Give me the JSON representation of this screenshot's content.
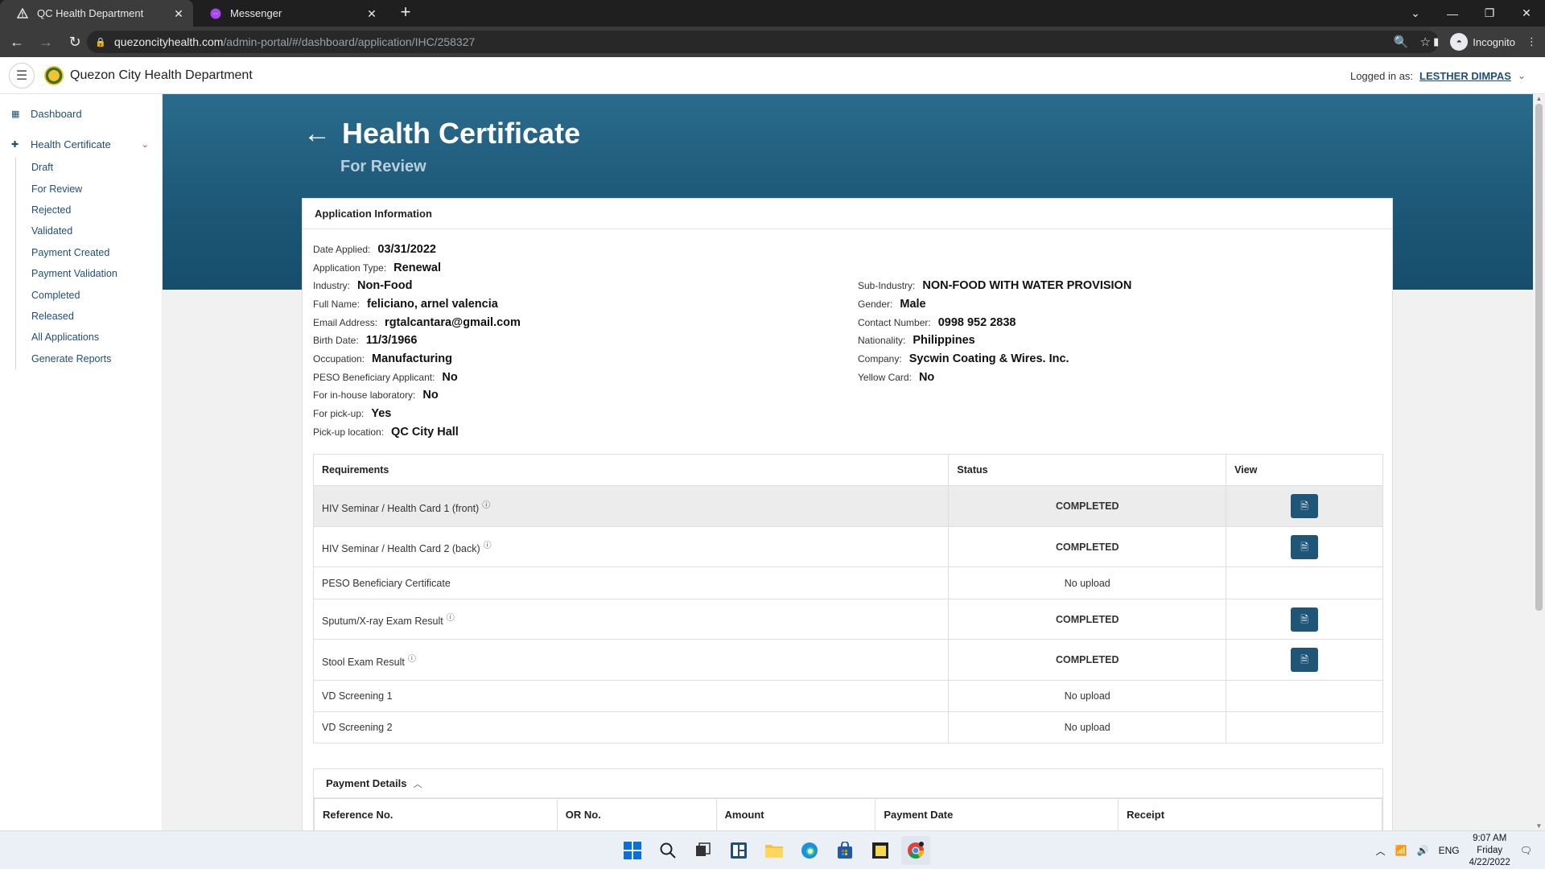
{
  "browser": {
    "tabs": [
      {
        "title": "QC Health Department",
        "icon": "triangle-warning-icon",
        "active": true
      },
      {
        "title": "Messenger",
        "icon": "messenger-icon",
        "active": false
      }
    ],
    "url_host": "quezoncityhealth.com",
    "url_path": "/admin-portal/#/dashboard/application/IHC/258327",
    "profile_label": "Incognito"
  },
  "header": {
    "app_title": "Quezon City Health Department",
    "logged_in_label": "Logged in as:",
    "user_name": "LESTHER DIMPAS"
  },
  "sidebar": {
    "dashboard": "Dashboard",
    "health_certificate": "Health Certificate",
    "sub_items": [
      "Draft",
      "For Review",
      "Rejected",
      "Validated",
      "Payment Created",
      "Payment Validation",
      "Completed",
      "Released",
      "All Applications",
      "Generate Reports"
    ]
  },
  "page": {
    "title": "Health Certificate",
    "subtitle": "For Review",
    "card_title": "Application Information"
  },
  "application": {
    "left": [
      {
        "label": "Date Applied:",
        "value": "03/31/2022"
      },
      {
        "label": "Application Type:",
        "value": "Renewal"
      },
      {
        "label": "Industry:",
        "value": "Non-Food"
      },
      {
        "label": "Full Name:",
        "value": "feliciano, arnel valencia"
      },
      {
        "label": "Email Address:",
        "value": "rgtalcantara@gmail.com"
      },
      {
        "label": "Birth Date:",
        "value": "11/3/1966"
      },
      {
        "label": "Occupation:",
        "value": "Manufacturing"
      },
      {
        "label": "PESO Beneficiary Applicant:",
        "value": "No"
      },
      {
        "label": "For in-house laboratory:",
        "value": "No"
      },
      {
        "label": "For pick-up:",
        "value": "Yes"
      },
      {
        "label": "Pick-up location:",
        "value": "QC City Hall"
      }
    ],
    "right": [
      {
        "label": "Sub-Industry:",
        "value": "NON-FOOD WITH WATER PROVISION"
      },
      {
        "label": "Gender:",
        "value": "Male"
      },
      {
        "label": "Contact Number:",
        "value": "0998 952 2838"
      },
      {
        "label": "Nationality:",
        "value": "Philippines"
      },
      {
        "label": "Company:",
        "value": "Sycwin Coating & Wires. Inc."
      },
      {
        "label": "Yellow Card:",
        "value": "No"
      }
    ]
  },
  "requirements": {
    "headers": [
      "Requirements",
      "Status",
      "View"
    ],
    "rows": [
      {
        "name": "HIV Seminar / Health Card 1 (front)",
        "status": "COMPLETED",
        "info": true,
        "view": true
      },
      {
        "name": "HIV Seminar / Health Card 2 (back)",
        "status": "COMPLETED",
        "info": true,
        "view": true
      },
      {
        "name": "PESO Beneficiary Certificate",
        "status": "No upload",
        "info": false,
        "view": false
      },
      {
        "name": "Sputum/X-ray Exam Result",
        "status": "COMPLETED",
        "info": true,
        "view": true
      },
      {
        "name": "Stool Exam Result",
        "status": "COMPLETED",
        "info": true,
        "view": true
      },
      {
        "name": "VD Screening 1",
        "status": "No upload",
        "info": false,
        "view": false
      },
      {
        "name": "VD Screening 2",
        "status": "No upload",
        "info": false,
        "view": false
      }
    ]
  },
  "payment": {
    "title": "Payment Details",
    "headers": [
      "Reference No.",
      "OR No.",
      "Amount",
      "Payment Date",
      "Receipt"
    ]
  },
  "taskbar": {
    "tray_lang": "ENG",
    "time": "9:07 AM",
    "day": "Friday",
    "date": "4/22/2022"
  },
  "colors": {
    "banner": "#1c5777",
    "accent": "#1f4e79",
    "completed": "#1f6b2f",
    "view_button": "#1f5678"
  }
}
